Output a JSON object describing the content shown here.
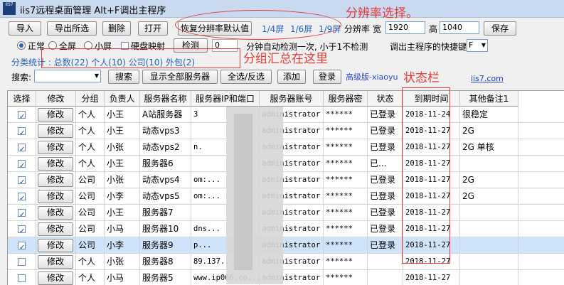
{
  "app": {
    "title": "iis7远程桌面管理 Alt+F调出主程序",
    "icon_text": "IIS7"
  },
  "toolbar": {
    "import": "导入",
    "export": "导出所选",
    "delete": "删除",
    "open": "打开",
    "restore_resolution": "恢复分辨率默认值",
    "quarter": "1/4屏",
    "sixth": "1/6屏",
    "ninth": "1/9屏",
    "resolution_label": "分辨率",
    "width_label": "宽",
    "width_value": "1920",
    "height_label": "高",
    "height_value": "1040",
    "save": "保存"
  },
  "modes": {
    "normal": "正常",
    "fullscreen": "全屏",
    "small": "小屏",
    "disk_map": "硬盘映射",
    "check": "检测",
    "check_minutes": "0",
    "check_hint": "分钟自动检测一次, 小于1不检测",
    "hotkey_label": "调出主程序的快捷键: Al",
    "hotkey_value": "F"
  },
  "group_stats": {
    "label": "分类统计 : 总数(22) 个人(10) 公司(10) 外包(2)"
  },
  "search": {
    "label": "搜索:",
    "search_btn": "搜索",
    "show_all": "显示全部服务器",
    "select_all": "全选/反选",
    "add": "添加",
    "login": "登录",
    "edition": "高级版-xiaoyu",
    "site": "iis7.com"
  },
  "annotations": {
    "resolution": "分辨率选择。",
    "group": "分组汇总在这里",
    "status": "状态栏"
  },
  "table": {
    "headers": [
      "选择",
      "修改",
      "分组",
      "负责人",
      "服务器名称",
      "服务器IP和端口",
      "服务器账号",
      "服务器密",
      "状态",
      "到期时间",
      "其他备注1"
    ],
    "edit_label": "修改",
    "rows": [
      {
        "checked": true,
        "group": "个人",
        "owner": "小王",
        "name": "A站服务器",
        "ip": "3",
        "account": "administrator",
        "password": "******",
        "status": "已登录",
        "expire": "2018-11-24",
        "note": "很稳定"
      },
      {
        "checked": true,
        "group": "个人",
        "owner": "小王",
        "name": "动态vps3",
        "ip": "",
        "account": "administrator",
        "password": "******",
        "status": "已登录",
        "expire": "2018-11-27",
        "note": "2G"
      },
      {
        "checked": true,
        "group": "个人",
        "owner": "小张",
        "name": "动态vps2",
        "ip": "n.",
        "account": "administrator",
        "password": "******",
        "status": "已登录",
        "expire": "2018-11-27",
        "note": "2G 单核"
      },
      {
        "checked": true,
        "group": "个人",
        "owner": "小王",
        "name": "服务器6",
        "ip": "",
        "account": "administrator",
        "password": "******",
        "status": "已...",
        "expire": "2018-11-27",
        "note": ""
      },
      {
        "checked": true,
        "group": "公司",
        "owner": "小张",
        "name": "动态vps4",
        "ip": "om:...",
        "account": "administrator",
        "password": "******",
        "status": "已登录",
        "expire": "2018-11-27",
        "note": "2G"
      },
      {
        "checked": true,
        "group": "公司",
        "owner": "小李",
        "name": "动态vps5",
        "ip": "om:...",
        "account": "administrator",
        "password": "******",
        "status": "已登录",
        "expire": "2018-11-27",
        "note": "2G"
      },
      {
        "checked": true,
        "group": "公司",
        "owner": "小王",
        "name": "服务器7",
        "ip": "",
        "account": "administrator",
        "password": "******",
        "status": "已登录",
        "expire": "2018-11-27",
        "note": ""
      },
      {
        "checked": true,
        "group": "公司",
        "owner": "小马",
        "name": "服务器10",
        "ip": "dns...",
        "account": "administrator",
        "password": "******",
        "status": "已登录",
        "expire": "2018-11-27",
        "note": ""
      },
      {
        "checked": true,
        "group": "公司",
        "owner": "小李",
        "name": "服务器9",
        "ip": "p...",
        "account": "administrator",
        "password": "******",
        "status": "已登录",
        "expire": "2018-11-27",
        "note": ""
      },
      {
        "checked": false,
        "group": "个人",
        "owner": "小张",
        "name": "服务器8",
        "ip": "89.137...",
        "account": "administrator",
        "password": "******",
        "status": "",
        "expire": "2018-11-27",
        "note": ""
      },
      {
        "checked": false,
        "group": "个人",
        "owner": "小马",
        "name": "服务器5",
        "ip": "www.ip066.co...",
        "account": "administrator",
        "password": "******",
        "status": "",
        "expire": "2018-11-27",
        "note": ""
      }
    ]
  }
}
